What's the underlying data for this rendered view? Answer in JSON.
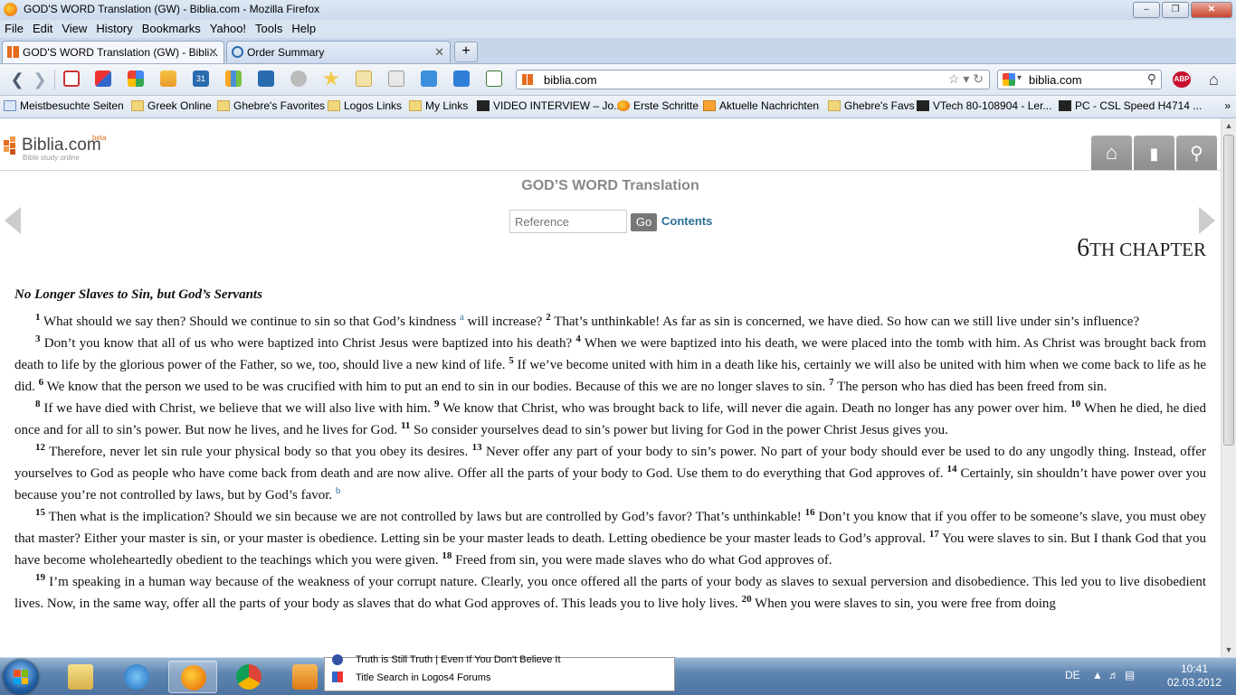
{
  "window": {
    "title": "GOD'S WORD Translation (GW) - Biblia.com - Mozilla Firefox"
  },
  "menu": [
    "File",
    "Edit",
    "View",
    "History",
    "Bookmarks",
    "Yahoo!",
    "Tools",
    "Help"
  ],
  "tabs": [
    {
      "label": "GOD'S WORD Translation (GW) - Bibli...",
      "active": true
    },
    {
      "label": "Order Summary",
      "active": false
    }
  ],
  "newtab_label": "+",
  "urlbar": {
    "value": "biblia.com"
  },
  "searchbar": {
    "value": "biblia.com"
  },
  "abp_label": "ABP",
  "bookmarks": [
    {
      "label": "Meistbesuchte Seiten",
      "icon": "page-icon"
    },
    {
      "label": "Greek Online",
      "icon": "folder-icon"
    },
    {
      "label": "Ghebre's Favorites",
      "icon": "folder-icon"
    },
    {
      "label": "Logos Links",
      "icon": "folder-icon"
    },
    {
      "label": "My Links",
      "icon": "folder-icon"
    },
    {
      "label": "VIDEO INTERVIEW – Jo...",
      "icon": "amazon-icon"
    },
    {
      "label": "Erste Schritte",
      "icon": "firefox-icon"
    },
    {
      "label": "Aktuelle Nachrichten",
      "icon": "rss-icon"
    },
    {
      "label": "Ghebre's Favs",
      "icon": "folder-icon"
    },
    {
      "label": "VTech 80-108904 - Ler...",
      "icon": "amazon-icon"
    },
    {
      "label": "PC - CSL Speed H4714 ...",
      "icon": "amazon-icon"
    }
  ],
  "bookmarks_more": "»",
  "site": {
    "logo_text": "Biblia",
    "logo_suffix": ".com",
    "logo_beta": "beta",
    "logo_sub": "Bible study online",
    "translation_title": "GOD’S WORD Translation",
    "reference_placeholder": "Reference",
    "go_label": "Go",
    "contents_label": "Contents",
    "chapter_num": "6",
    "chapter_word": "TH CHAPTER"
  },
  "passage": {
    "heading": "No Longer Slaves to Sin, but God’s Servants",
    "paragraphs": [
      [
        {
          "v": "1",
          "t": "What should we say then? Should we continue to sin so that God’s kindness "
        },
        {
          "fn": "a"
        },
        {
          "t": " will increase? "
        },
        {
          "v": "2",
          "t": "That’s unthinkable! As far as sin is concerned, we have died. So how can we still live under sin’s influence?"
        }
      ],
      [
        {
          "v": "3",
          "t": "Don’t you know that all of us who were baptized into Christ Jesus were baptized into his death? "
        },
        {
          "v": "4",
          "t": "When we were baptized into his death, we were placed into the tomb with him. As Christ was brought back from death to life by the glorious power of the Father, so we, too, should live a new kind of life. "
        },
        {
          "v": "5",
          "t": "If we’ve become united with him in a death like his, certainly we will also be united with him when we come back to life as he did. "
        },
        {
          "v": "6",
          "t": "We know that the person we used to be was crucified with him to put an end to sin in our bodies. Because of this we are no longer slaves to sin. "
        },
        {
          "v": "7",
          "t": "The person who has died has been freed from sin."
        }
      ],
      [
        {
          "v": "8",
          "t": "If we have died with Christ, we believe that we will also live with him. "
        },
        {
          "v": "9",
          "t": "We know that Christ, who was brought back to life, will never die again. Death no longer has any power over him. "
        },
        {
          "v": "10",
          "t": "When he died, he died once and for all to sin’s power. But now he lives, and he lives for God. "
        },
        {
          "v": "11",
          "t": "So consider yourselves dead to sin’s power but living for God in the power Christ Jesus gives you."
        }
      ],
      [
        {
          "v": "12",
          "t": "Therefore, never let sin rule your physical body so that you obey its desires. "
        },
        {
          "v": "13",
          "t": "Never offer any part of your body to sin’s power. No part of your body should ever be used to do any ungodly thing. Instead, offer yourselves to God as people who have come back from death and are now alive. Offer all the parts of your body to God. Use them to do everything that God approves of. "
        },
        {
          "v": "14",
          "t": "Certainly, sin shouldn’t have power over you because you’re not controlled by laws, but by God’s favor. "
        },
        {
          "fn": "b"
        }
      ],
      [
        {
          "v": "15",
          "t": "Then what is the implication? Should we sin because we are not controlled by laws but are controlled by God’s favor? That’s unthinkable! "
        },
        {
          "v": "16",
          "t": "Don’t you know that if you offer to be someone’s slave, you must obey that master? Either your master is sin, or your master is obedience. Letting sin be your master leads to death. Letting obedience be your master leads to God’s approval. "
        },
        {
          "v": "17",
          "t": "You were slaves to sin. But I thank God that you have become wholeheartedly obedient to the teachings which you were given. "
        },
        {
          "v": "18",
          "t": "Freed from sin, you were made slaves who do what God approves of."
        }
      ],
      [
        {
          "v": "19",
          "t": "I’m speaking in a human way because of the weakness of your corrupt nature. Clearly, you once offered all the parts of your body as slaves to sexual perversion and disobedience. This led you to live disobedient lives. Now, in the same way, offer all the parts of your body as slaves that do what God approves of. This leads you to live holy lives. "
        },
        {
          "v": "20",
          "t": "When you were slaves to sin, you were free from doing"
        }
      ]
    ]
  },
  "popup": {
    "rows": [
      "Truth is Still Truth | Even If You Don't Believe It",
      "Title Search in Logos4 Forums"
    ]
  },
  "taskbar": {
    "language": "DE",
    "time": "10:41",
    "date": "02.03.2012"
  },
  "colors": {
    "accent": "#2d6f98",
    "logo_orange": "#e56b1f"
  }
}
